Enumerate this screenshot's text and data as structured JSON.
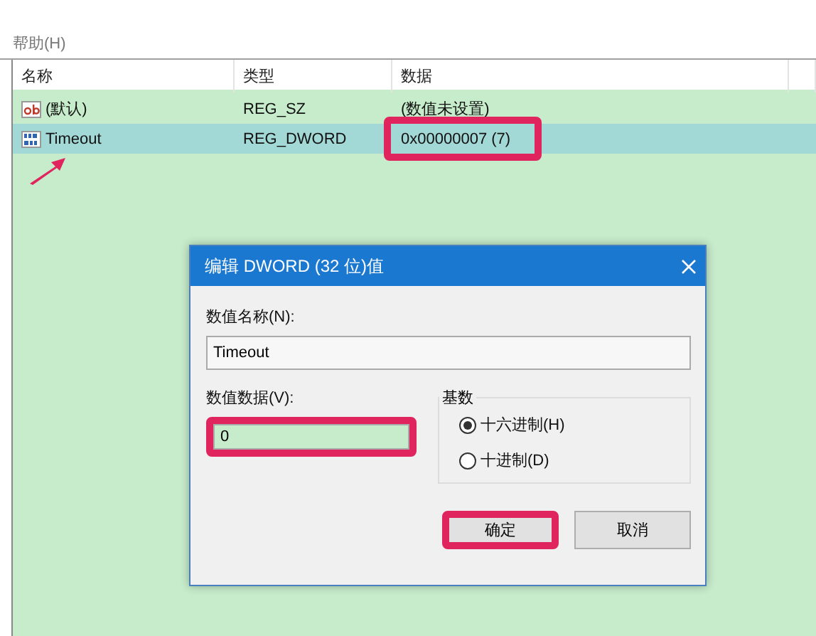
{
  "menu": [
    {
      "label": "帮助(H)"
    }
  ],
  "table": {
    "columns": [
      "名称",
      "类型",
      "数据"
    ],
    "rows": [
      {
        "kind": "string",
        "name": "(默认)",
        "type": "REG_SZ",
        "data": "(数值未设置)",
        "selected": false,
        "highlighted": false,
        "pointed": false
      },
      {
        "kind": "number",
        "name": "Timeout",
        "type": "REG_DWORD",
        "data": "0x00000007 (7)",
        "selected": true,
        "highlighted": true,
        "pointed": true
      }
    ]
  },
  "dialog": {
    "title": "编辑 DWORD (32 位)值",
    "name_label": "数值名称(N):",
    "name_value": "Timeout",
    "data_label": "数值数据(V):",
    "data_value": "0",
    "data_highlighted": true,
    "base": {
      "title": "基数",
      "options": [
        {
          "label": "十六进制(H)",
          "selected": true
        },
        {
          "label": "十进制(D)",
          "selected": false
        }
      ]
    },
    "buttons": [
      {
        "label": "确定",
        "highlighted": true
      },
      {
        "label": "取消",
        "highlighted": false
      }
    ]
  }
}
